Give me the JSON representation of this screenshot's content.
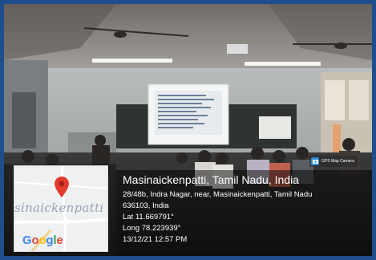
{
  "photo": {
    "description_icon": "classroom-photo"
  },
  "map": {
    "place_label": "sinaickenpatti",
    "pin_icon": "map-pin-icon",
    "logo_text": "Google",
    "logo_colors": [
      "#4285F4",
      "#EA4335",
      "#FBBC05",
      "#4285F4",
      "#34A853",
      "#EA4335"
    ]
  },
  "badge": {
    "icon": "camera-icon",
    "text": "GPS Map Camera"
  },
  "location": {
    "title": "Masinaickenpatti, Tamil Nadu, India",
    "address_line1": "28/48b, Indra Nagar, near, Masinaickenpatti, Tamil Nadu",
    "address_line2": "636103, India",
    "lat": "Lat 11.669791°",
    "long": "Long 78.223939°",
    "datetime": "13/12/21 12:57 PM"
  },
  "colors": {
    "frame": "#1f4e8c",
    "pin": "#e23b2e",
    "overlay": "rgba(0,0,0,0.55)"
  }
}
